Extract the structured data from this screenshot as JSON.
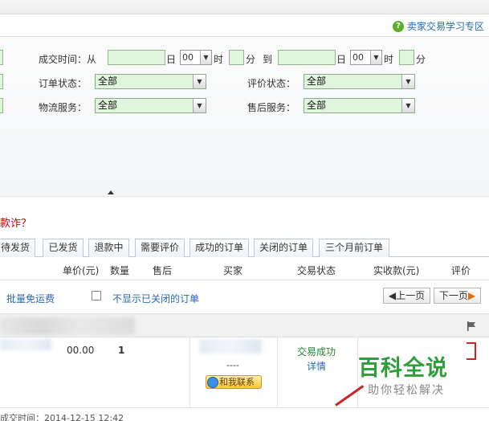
{
  "help": {
    "link": "卖家交易学习专区"
  },
  "search": {
    "deal_time_label": "成交时间：",
    "from": "从",
    "day": "日",
    "hour_value": "00",
    "hour": "时",
    "minute": "分",
    "to": "到",
    "order_status_label": "订单状态：",
    "order_status_value": "全部",
    "review_status_label": "评价状态：",
    "review_status_value": "全部",
    "logistics_label": "物流服务：",
    "logistics_value": "全部",
    "aftersale_label": "售后服务：",
    "aftersale_value": "全部"
  },
  "fraud_link": "款诈？",
  "tabs": [
    "待发货",
    "已发货",
    "退款中",
    "需要评价",
    "成功的订单",
    "关闭的订单",
    "三个月前订单"
  ],
  "columns": [
    "单价(元)",
    "数量",
    "售后",
    "买家",
    "交易状态",
    "实收款(元)",
    "评价"
  ],
  "toolbar": {
    "batch_free_shipping": "批量免运费",
    "hide_closed": "不显示已关闭的订单",
    "prev": "上一页",
    "next": "下一页"
  },
  "order": {
    "price": "00.00",
    "quantity": "1",
    "dashes": "----",
    "contact": "和我联系",
    "status": "交易成功",
    "detail": "详情"
  },
  "watermark": {
    "title": "百科全说",
    "subtitle": "助你轻松解决"
  },
  "footer": "成交时间：2014-12-15 12:42"
}
